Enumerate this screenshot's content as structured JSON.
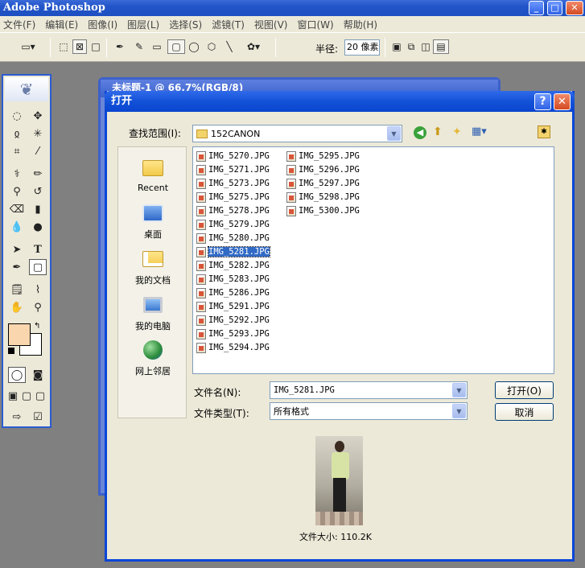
{
  "app": {
    "title": "Adobe Photoshop"
  },
  "menu": [
    "文件(F)",
    "编辑(E)",
    "图像(I)",
    "图层(L)",
    "选择(S)",
    "滤镜(T)",
    "视图(V)",
    "窗口(W)",
    "帮助(H)"
  ],
  "options": {
    "radius_label": "半径:",
    "radius_value": "20 像素"
  },
  "doc_window": {
    "title": "未标题-1 @ 66.7%(RGB/8)"
  },
  "dialog": {
    "title": "打开",
    "look_in_label": "查找范围(I):",
    "look_in_value": "152CANON",
    "places": [
      {
        "label": "Recent",
        "icon": "recent-folder-icon"
      },
      {
        "label": "桌面",
        "icon": "desktop-icon"
      },
      {
        "label": "我的文档",
        "icon": "my-documents-icon"
      },
      {
        "label": "我的电脑",
        "icon": "my-computer-icon"
      },
      {
        "label": "网上邻居",
        "icon": "network-places-icon"
      }
    ],
    "files_col1": [
      "IMG_5270.JPG",
      "IMG_5271.JPG",
      "IMG_5273.JPG",
      "IMG_5275.JPG",
      "IMG_5278.JPG",
      "IMG_5279.JPG",
      "IMG_5280.JPG",
      "IMG_5281.JPG",
      "IMG_5282.JPG",
      "IMG_5283.JPG",
      "IMG_5286.JPG",
      "IMG_5291.JPG",
      "IMG_5292.JPG",
      "IMG_5293.JPG",
      "IMG_5294.JPG"
    ],
    "files_col2": [
      "IMG_5295.JPG",
      "IMG_5296.JPG",
      "IMG_5297.JPG",
      "IMG_5298.JPG",
      "IMG_5300.JPG"
    ],
    "selected_file": "IMG_5281.JPG",
    "filename_label": "文件名(N):",
    "filename_value": "IMG_5281.JPG",
    "filetype_label": "文件类型(T):",
    "filetype_value": "所有格式",
    "open_button": "打开(O)",
    "cancel_button": "取消",
    "file_size": "文件大小: 110.2K"
  },
  "colors": {
    "foreground": "#f9d6ae",
    "background": "#ffffff",
    "selection": "#316ac5",
    "titlebar": "#1352d8"
  }
}
